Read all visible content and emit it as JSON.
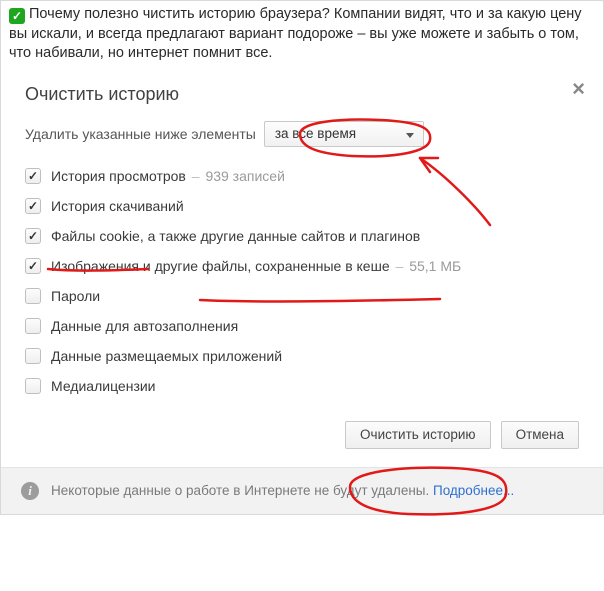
{
  "tip": {
    "text": "Почему полезно чистить историю браузера? Компании видят, что и за какую цену вы искали, и всегда предлагают вариант подороже – вы уже можете и забыть о том, что набивали, но интернет помнит все."
  },
  "dialog": {
    "title": "Очистить историю",
    "delete_label": "Удалить указанные ниже элементы",
    "range_selected": "за все время",
    "options": [
      {
        "label": "История просмотров",
        "checked": true,
        "meta": "939 записей"
      },
      {
        "label": "История скачиваний",
        "checked": true
      },
      {
        "label": "Файлы cookie, а также другие данные сайтов и плагинов",
        "checked": true
      },
      {
        "label": "Изображения и другие файлы, сохраненные в кеше",
        "checked": true,
        "meta": "55,1 МБ"
      },
      {
        "label": "Пароли",
        "checked": false
      },
      {
        "label": "Данные для автозаполнения",
        "checked": false
      },
      {
        "label": "Данные размещаемых приложений",
        "checked": false
      },
      {
        "label": "Медиалицензии",
        "checked": false
      }
    ],
    "buttons": {
      "clear": "Очистить историю",
      "cancel": "Отмена"
    },
    "notice": {
      "text": "Некоторые данные о работе в Интернете не будут удалены.",
      "link": "Подробнее..."
    }
  },
  "annotations": {
    "color": "#e11919"
  }
}
